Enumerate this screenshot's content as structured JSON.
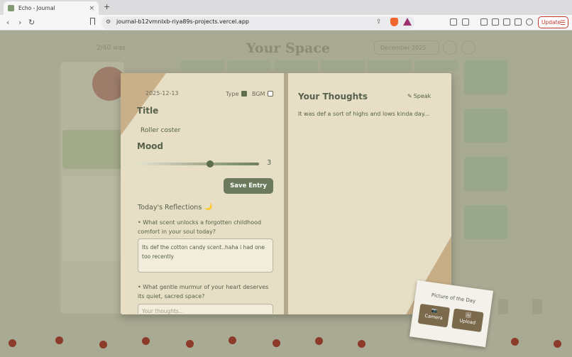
{
  "browser": {
    "tab_title": "Echo - Journal",
    "tab_close": "×",
    "new_tab": "+",
    "url": "journal-b12vmnlxb-riya89s-projects.vercel.app",
    "back": "‹",
    "forward": "›",
    "reload": "↻",
    "update_label": "Update",
    "menu_glyph": "☰"
  },
  "background": {
    "date": "2/40 was",
    "title": "Your Space",
    "month": "December 2025"
  },
  "journal": {
    "date": "2025-12-13",
    "type_label": "Type",
    "type_checked": true,
    "bgm_label": "BGM",
    "bgm_checked": false,
    "title_label": "Title",
    "title_value": "Roller coster",
    "mood_label": "Mood",
    "mood_value": "3",
    "save_label": "Save Entry",
    "reflections_title": "Today's Reflections",
    "reflections_icon": "🌙",
    "question1": "• What scent unlocks a forgotten childhood comfort in your soul today?",
    "answer1": "Its def the cotton candy scent..haha i had one too recently",
    "question2": "• What gentle murmur of your heart deserves its quiet, sacred space?",
    "answer2_placeholder": "Your thoughts...",
    "thoughts_title": "Your Thoughts",
    "speak_icon": "✎",
    "speak_label": "Speak",
    "thoughts_text": "It was def a sort of highs and lows kinda day..."
  },
  "picture_of_day": {
    "title": "Picture of the Day",
    "camera_icon": "📷",
    "camera_label": "Camera",
    "upload_icon": "🖼",
    "upload_label": "Upload"
  },
  "colors": {
    "accent": "#6b7a5c",
    "paper": "#e7dec6",
    "update_red": "#c0392b"
  }
}
